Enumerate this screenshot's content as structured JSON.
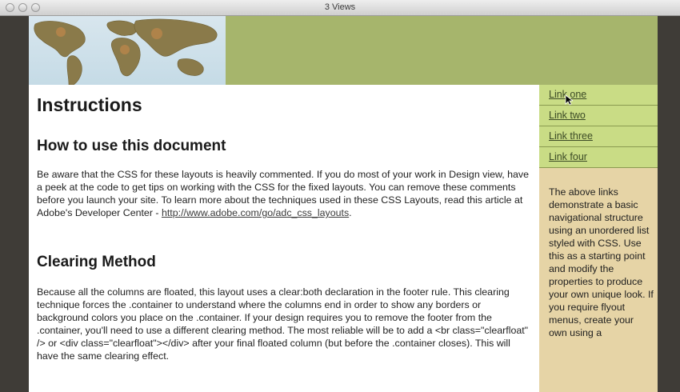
{
  "window": {
    "title": "3 Views"
  },
  "main": {
    "heading": "Instructions",
    "section1_title": "How to use this document",
    "section1_text": "Be aware that the CSS for these layouts is heavily commented. If you do most of your work in Design view, have a peek at the code to get tips on working with the CSS for the fixed layouts. You can remove these comments before you launch your site. To learn more about the techniques used in these CSS Layouts, read this article at Adobe's Developer Center - ",
    "section1_link": "http://www.adobe.com/go/adc_css_layouts",
    "section1_end": ".",
    "section2_title": "Clearing Method",
    "section2_text": "Because all the columns are floated, this layout uses a clear:both declaration in the footer rule. This clearing technique forces the .container to understand where the columns end in order to show any borders or background colors you place on the .container. If your design requires you to remove the footer from the .container, you'll need to use a different clearing method. The most reliable will be to add a <br class=\"clearfloat\" /> or <div class=\"clearfloat\"></div> after your final floated column (but before the .container closes). This will have the same clearing effect."
  },
  "sidebar": {
    "links": [
      {
        "label": "Link one"
      },
      {
        "label": "Link two"
      },
      {
        "label": "Link three"
      },
      {
        "label": "Link four"
      }
    ],
    "text": "The above links demonstrate a basic navigational structure using an unordered list styled with CSS. Use this as a starting point and modify the properties to produce your own unique look. If you require flyout menus, create your own using a"
  },
  "colors": {
    "header": "#a6b56c",
    "nav_bg": "#c9dc85",
    "sidebar_bg": "#e6d4a6",
    "frame": "#3f3c37"
  }
}
